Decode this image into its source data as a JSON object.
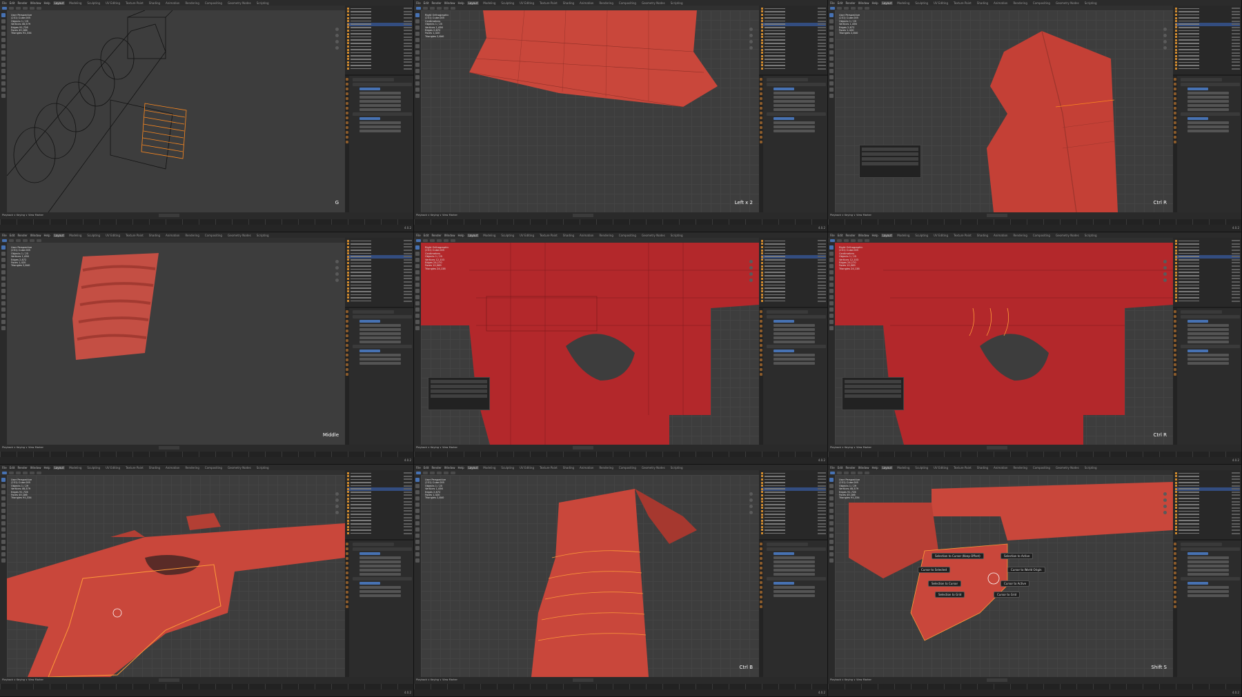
{
  "topbar": {
    "menus": [
      "File",
      "Edit",
      "Render",
      "Window",
      "Help"
    ],
    "workspaces": [
      "Layout",
      "Modeling",
      "Sculpting",
      "UV Editing",
      "Texture Paint",
      "Shading",
      "Animation",
      "Rendering",
      "Compositing",
      "Geometry Nodes",
      "Scripting"
    ],
    "active_workspace": "Layout"
  },
  "timeline_label": "Playback ∨ Keying ∨ View Marker",
  "status_version": "4.0.2",
  "panels": [
    {
      "name": "panel-1",
      "stats": [
        "User Perspective",
        "(231) Cube.005",
        "Objects   1 / 29",
        "Vertices  46,579",
        "Edges    91,726",
        "Faces   45,186",
        "Triangles  91,334"
      ],
      "key_hint": "G",
      "colors": {
        "mesh": "#000000",
        "selection": "#ff8a1f"
      }
    },
    {
      "name": "panel-2",
      "stats": [
        "Right Orthographic",
        "(231) Cube.005",
        "Centimeters",
        "Objects  1 / 25",
        "Vertices  1,456",
        "Edges  2,872",
        "Faces  1,420",
        "Triangles  2,840"
      ],
      "key_hint": "Left x 2",
      "colors": {
        "mesh": "#c9473b"
      }
    },
    {
      "name": "panel-3",
      "stats": [
        "User Perspective",
        "(231) Cube.005",
        "Objects  1 / 25",
        "Vertices  1,456",
        "Edges  2,872",
        "Faces  1,420",
        "Triangles  2,840"
      ],
      "key_hint": "Ctrl R",
      "colors": {
        "mesh": "#c9473b"
      }
    },
    {
      "name": "panel-4",
      "stats": [
        "User Perspective",
        "(231) Cube.005",
        "Objects  1 / 25",
        "Vertices  1,456",
        "Edges  2,872",
        "Faces  1,420",
        "Triangles  2,840"
      ],
      "key_hint": "Middle",
      "colors": {
        "mesh": "#c9473b"
      }
    },
    {
      "name": "panel-5",
      "stats": [
        "Right Orthographic",
        "(231) Cube.005",
        "Centimeters",
        "Objects  1 / 25",
        "Vertices  12,103",
        "Edges  24,170",
        "Faces  12,069",
        "Triangles  24,138"
      ],
      "key_hint": "",
      "colors": {
        "mesh": "#b3282b"
      }
    },
    {
      "name": "panel-6",
      "stats": [
        "Right Orthographic",
        "(231) Cube.005",
        "Centimeters",
        "Objects  1 / 25",
        "Vertices  12,103",
        "Edges  24,170",
        "Faces  12,069",
        "Triangles  24,138"
      ],
      "key_hint": "Ctrl R",
      "colors": {
        "mesh": "#b3282b"
      }
    },
    {
      "name": "panel-7",
      "stats": [
        "User Perspective",
        "(231) Cube.005",
        "Objects  1 / 29",
        "Vertices  46,579",
        "Edges  91,726",
        "Faces  45,186",
        "Triangles  91,334"
      ],
      "key_hint": "",
      "colors": {
        "mesh": "#c9473b"
      }
    },
    {
      "name": "panel-8",
      "stats": [
        "User Perspective",
        "(231) Cube.005",
        "Objects  1 / 25",
        "Vertices  1,456",
        "Edges  2,872",
        "Faces  1,420",
        "Triangles  2,840"
      ],
      "key_hint": "Ctrl B",
      "colors": {
        "mesh": "#c9473b"
      }
    },
    {
      "name": "panel-9",
      "stats": [
        "User Perspective",
        "(231) Cube.005",
        "Objects  1 / 29",
        "Vertices  46,579",
        "Edges  91,726",
        "Faces  45,186",
        "Triangles  91,334"
      ],
      "key_hint": "Shift S",
      "colors": {
        "mesh": "#c9473b"
      },
      "pie_menu": [
        "Selection to Cursor (Keep Offset)",
        "Selection to Active",
        "Cursor to Selected",
        "Cursor to World Origin",
        "Selection to Cursor",
        "Cursor to Active",
        "Selection to Grid",
        "Cursor to Grid"
      ]
    }
  ]
}
